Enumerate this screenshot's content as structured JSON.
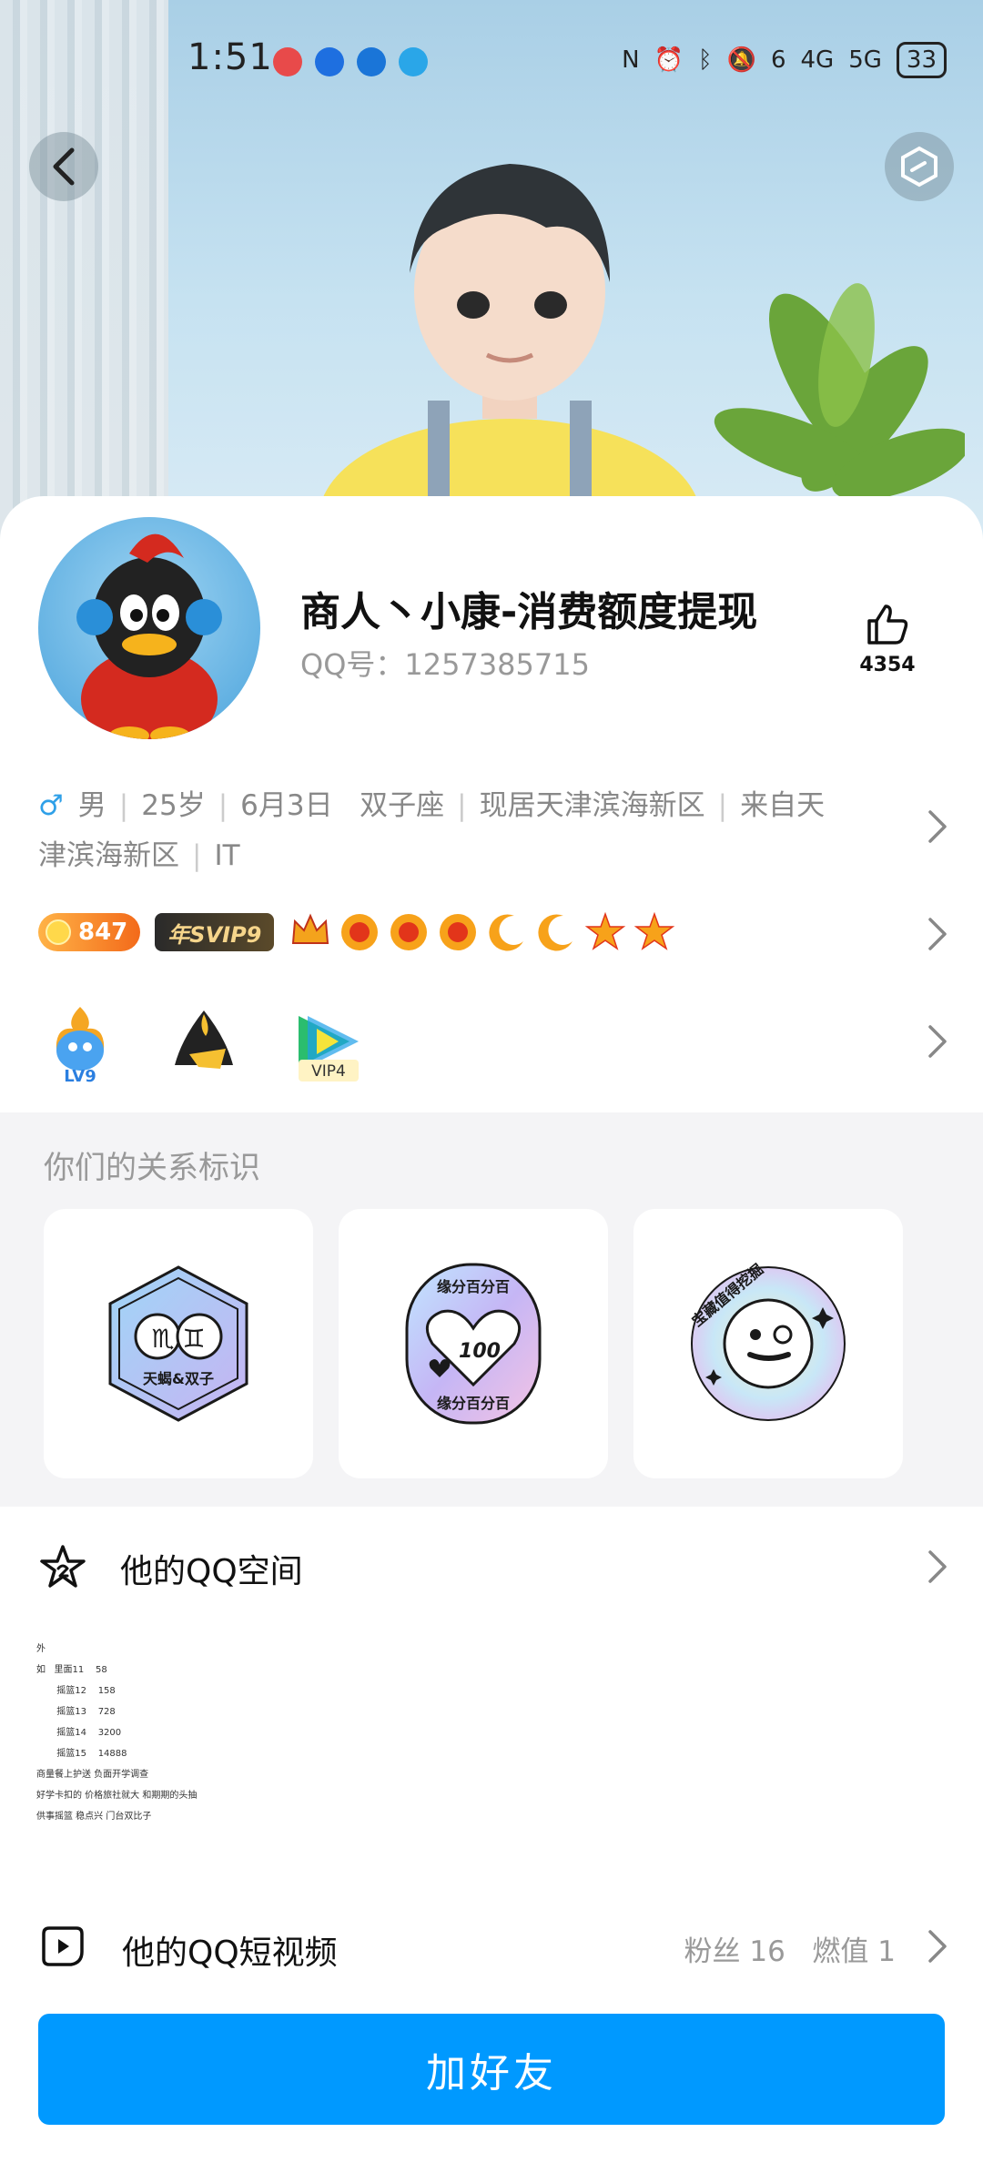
{
  "status_bar": {
    "time": "1:51",
    "battery": "33",
    "dot_colors": [
      "#e84a4a",
      "#1e6fe0",
      "#1a75d8",
      "#2aa6e8"
    ],
    "network_labels": [
      "6",
      "4G",
      "5G"
    ]
  },
  "profile": {
    "nickname": "商人丶小康-消费额度提现",
    "qq_number": "QQ号：1257385715",
    "likes": "4354",
    "gender_symbol": "♂",
    "gender": "男",
    "age": "25岁",
    "birthday": "6月3日",
    "zodiac": "双子座",
    "location": "现居天津滨海新区",
    "hometown": "来自天津滨海新区",
    "occupation": "IT"
  },
  "badges": {
    "coin_value": "847",
    "svip_label": "年SVIP9",
    "level_icons": [
      "crown-icon",
      "sun-icon",
      "sun-icon",
      "sun-icon",
      "moon-icon",
      "moon-icon",
      "star-icon",
      "star-icon"
    ]
  },
  "game_icons": {
    "lv_label": "LV9",
    "vip_label": "VIP4"
  },
  "relation": {
    "title": "你们的关系标识",
    "cards": [
      {
        "label": "天蝎&双子",
        "symbols": "♏ ♊"
      },
      {
        "label": "缘分百分百",
        "score": "100"
      },
      {
        "label": "宝藏值得挖掘"
      }
    ]
  },
  "qzone": {
    "title": "他的QQ空间",
    "preview_lines": [
      "外",
      "如   里面11    58",
      "       摇篮12    158",
      "       摇篮13    728",
      "       摇篮14    3200",
      "       摇篮15    14888",
      "商量餐上护送 负面开学调查",
      "好学卡扣的  价格旅社就大  和期期的头抽",
      "供事摇篮   稳点兴  门台双比子"
    ]
  },
  "short_video": {
    "title": "他的QQ短视频",
    "fans": "粉丝 16",
    "spark": "燃值 1"
  },
  "add_friend_label": "加好友",
  "colors": {
    "accent": "#0099ff",
    "male": "#2fa0e8"
  }
}
